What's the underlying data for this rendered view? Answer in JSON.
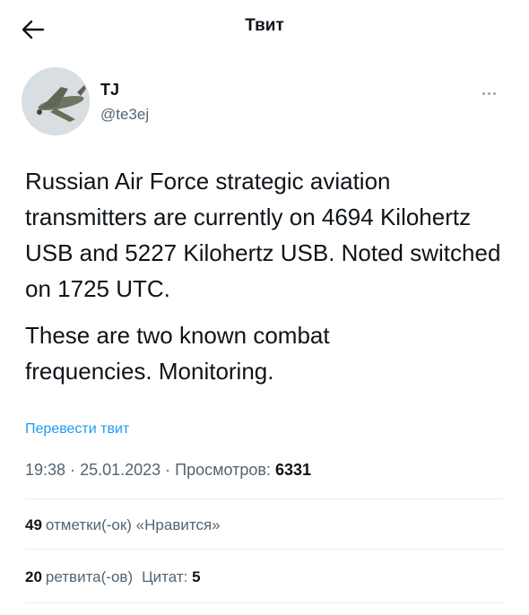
{
  "header": {
    "title": "Твит"
  },
  "user": {
    "name": "TJ",
    "handle": "@te3ej"
  },
  "tweet": {
    "paragraph1": "Russian Air Force strategic aviation transmitters are currently on 4694 Kilohertz USB and 5227 Kilohertz USB. Noted switched on 1725 UTC.",
    "paragraph2_lines": [
      "These are two known combat",
      "frequencies. Monitoring."
    ]
  },
  "translate_label": "Перевести твит",
  "meta": {
    "time": "19:38",
    "date": "25.01.2023",
    "views_label": "Просмотров:",
    "views_count": "6331"
  },
  "stats": {
    "likes_count": "49",
    "likes_label": "отметки(-ок) «Нравится»",
    "retweets_count": "20",
    "retweets_label": "ретвита(-ов)",
    "quotes_label": "Цитат:",
    "quotes_count": "5"
  },
  "colors": {
    "link": "#1d9bf0",
    "secondary_text": "#536471",
    "primary_text": "#0f1419"
  },
  "icons": {
    "back": "arrow-left-icon",
    "more": "more-horizontal-icon"
  }
}
